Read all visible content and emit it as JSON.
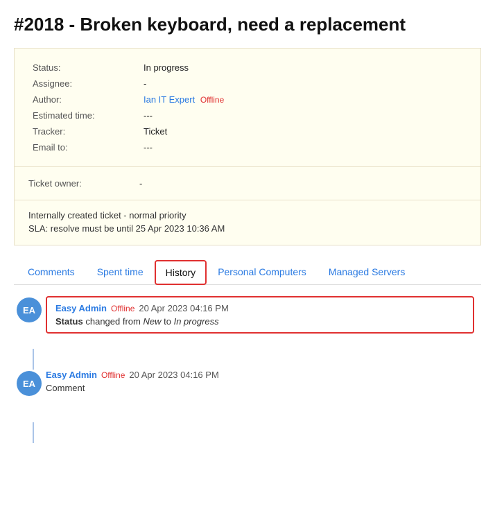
{
  "ticket": {
    "title": "#2018 - Broken keyboard, need a replacement",
    "fields": {
      "status_label": "Status:",
      "status_value": "In progress",
      "assignee_label": "Assignee:",
      "assignee_value": "-",
      "author_label": "Author:",
      "author_name": "Ian IT Expert",
      "author_status": "Offline",
      "estimated_label": "Estimated time:",
      "estimated_value": "---",
      "tracker_label": "Tracker:",
      "tracker_value": "Ticket",
      "email_label": "Email to:",
      "email_value": "---",
      "owner_label": "Ticket owner:",
      "owner_value": "-"
    },
    "notes": {
      "line1": "Internally created ticket - normal priority",
      "line2": "SLA: resolve must be until 25 Apr 2023 10:36 AM"
    }
  },
  "tabs": {
    "items": [
      {
        "id": "comments",
        "label": "Comments",
        "active": false
      },
      {
        "id": "spent-time",
        "label": "Spent time",
        "active": false
      },
      {
        "id": "history",
        "label": "History",
        "active": true
      },
      {
        "id": "personal-computers",
        "label": "Personal Computers",
        "active": false
      },
      {
        "id": "managed-servers",
        "label": "Managed Servers",
        "active": false
      }
    ]
  },
  "history": {
    "entries": [
      {
        "id": "entry1",
        "avatar": "EA",
        "user": "Easy Admin",
        "status": "Offline",
        "timestamp": "20 Apr 2023 04:16 PM",
        "body_prefix": "Status",
        "body_changed": "changed from",
        "body_from": "New",
        "body_to_text": "to",
        "body_to": "In progress",
        "highlighted": true
      },
      {
        "id": "entry2",
        "avatar": "EA",
        "user": "Easy Admin",
        "status": "Offline",
        "timestamp": "20 Apr 2023 04:16 PM",
        "comment": "Comment",
        "highlighted": false
      }
    ]
  }
}
